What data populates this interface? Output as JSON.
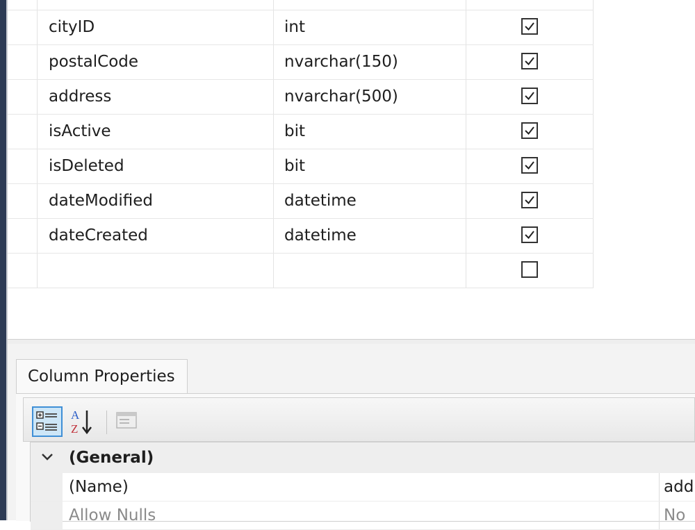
{
  "columns": [
    {
      "name": "",
      "type": "",
      "allow_nulls": true
    },
    {
      "name": "cityID",
      "type": "int",
      "allow_nulls": true
    },
    {
      "name": "postalCode",
      "type": "nvarchar(150)",
      "allow_nulls": true
    },
    {
      "name": "address",
      "type": "nvarchar(500)",
      "allow_nulls": true
    },
    {
      "name": "isActive",
      "type": "bit",
      "allow_nulls": true
    },
    {
      "name": "isDeleted",
      "type": "bit",
      "allow_nulls": true
    },
    {
      "name": "dateModified",
      "type": "datetime",
      "allow_nulls": true
    },
    {
      "name": "dateCreated",
      "type": "datetime",
      "allow_nulls": true
    },
    {
      "name": "",
      "type": "",
      "allow_nulls": false
    }
  ],
  "properties_panel": {
    "tab_label": "Column Properties",
    "toolbar": {
      "categorized_icon": "categorized-icon",
      "alphabetical_icon": "sort-alphabetical-icon",
      "property_pages_icon": "property-pages-icon"
    },
    "category": {
      "label": "(General)",
      "expanded": true
    },
    "rows": [
      {
        "name": "(Name)",
        "value": "add"
      },
      {
        "name": "Allow Nulls",
        "value": "No"
      }
    ]
  },
  "colors": {
    "accent": "#3f8fd6",
    "frame": "#2d3b55"
  }
}
